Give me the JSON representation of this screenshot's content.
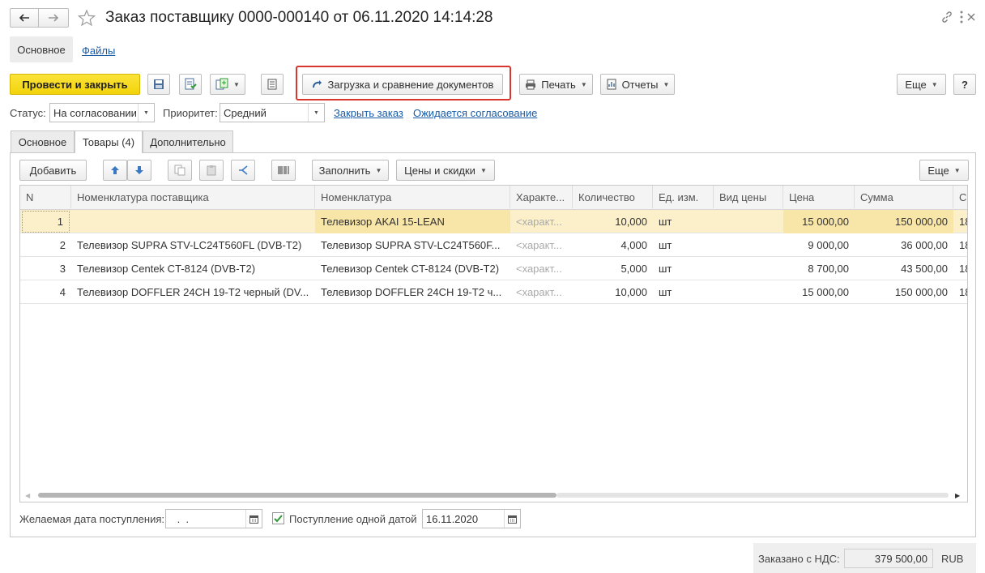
{
  "window": {
    "title": "Заказ поставщику 0000-000140 от 06.11.2020 14:14:28"
  },
  "nav_tabs": [
    {
      "label": "Основное"
    },
    {
      "label": "Файлы"
    }
  ],
  "toolbar": {
    "post_close": "Провести и закрыть",
    "load_compare": "Загрузка и сравнение документов",
    "print": "Печать",
    "reports": "Отчеты",
    "more": "Еще",
    "help": "?"
  },
  "status": {
    "status_label": "Статус:",
    "status_value": "На согласовании",
    "priority_label": "Приоритет:",
    "priority_value": "Средний",
    "close_order": "Закрыть заказ",
    "awaiting": "Ожидается согласование"
  },
  "tabs": [
    {
      "label": "Основное"
    },
    {
      "label": "Товары (4)"
    },
    {
      "label": "Дополнительно"
    }
  ],
  "table_toolbar": {
    "add": "Добавить",
    "fill": "Заполнить",
    "prices": "Цены и скидки",
    "more": "Еще"
  },
  "columns": [
    "N",
    "Номенклатура поставщика",
    "Номенклатура",
    "Характе...",
    "Количество",
    "Ед. изм.",
    "Вид цены",
    "Цена",
    "Сумма",
    "С"
  ],
  "rows": [
    {
      "n": "1",
      "supplier_item": "",
      "item": "Телевизор AKAI 15-LEAN",
      "char": "<характ...",
      "qty": "10,000",
      "unit": "шт",
      "price_type": "",
      "price": "15 000,00",
      "sum": "150 000,00",
      "extra": "18"
    },
    {
      "n": "2",
      "supplier_item": "Телевизор SUPRA STV-LC24T560FL (DVB-T2)",
      "item": "Телевизор SUPRA STV-LC24T560F...",
      "char": "<характ...",
      "qty": "4,000",
      "unit": "шт",
      "price_type": "",
      "price": "9 000,00",
      "sum": "36 000,00",
      "extra": "18"
    },
    {
      "n": "3",
      "supplier_item": "Телевизор Centek CT-8124 (DVB-T2)",
      "item": "Телевизор Centek CT-8124 (DVB-T2)",
      "char": "<характ...",
      "qty": "5,000",
      "unit": "шт",
      "price_type": "",
      "price": "8 700,00",
      "sum": "43 500,00",
      "extra": "18"
    },
    {
      "n": "4",
      "supplier_item": "Телевизор DOFFLER 24CH 19-T2 черный (DV...",
      "item": "Телевизор DOFFLER 24CH 19-T2 ч...",
      "char": "<характ...",
      "qty": "10,000",
      "unit": "шт",
      "price_type": "",
      "price": "15 000,00",
      "sum": "150 000,00",
      "extra": "18"
    }
  ],
  "footer": {
    "desired_date_label": "Желаемая дата поступления:",
    "desired_date_value": " .  .",
    "single_date_label": "Поступление одной датой",
    "single_date_value": "16.11.2020",
    "ordered_label": "Заказано с НДС:",
    "ordered_value": "379 500,00",
    "currency": "RUB"
  },
  "colors": {
    "accent_yellow": "#f5d80f",
    "selected_row": "#fbf0c9",
    "highlight_box": "#d9362f",
    "link": "#1a5ba6"
  }
}
